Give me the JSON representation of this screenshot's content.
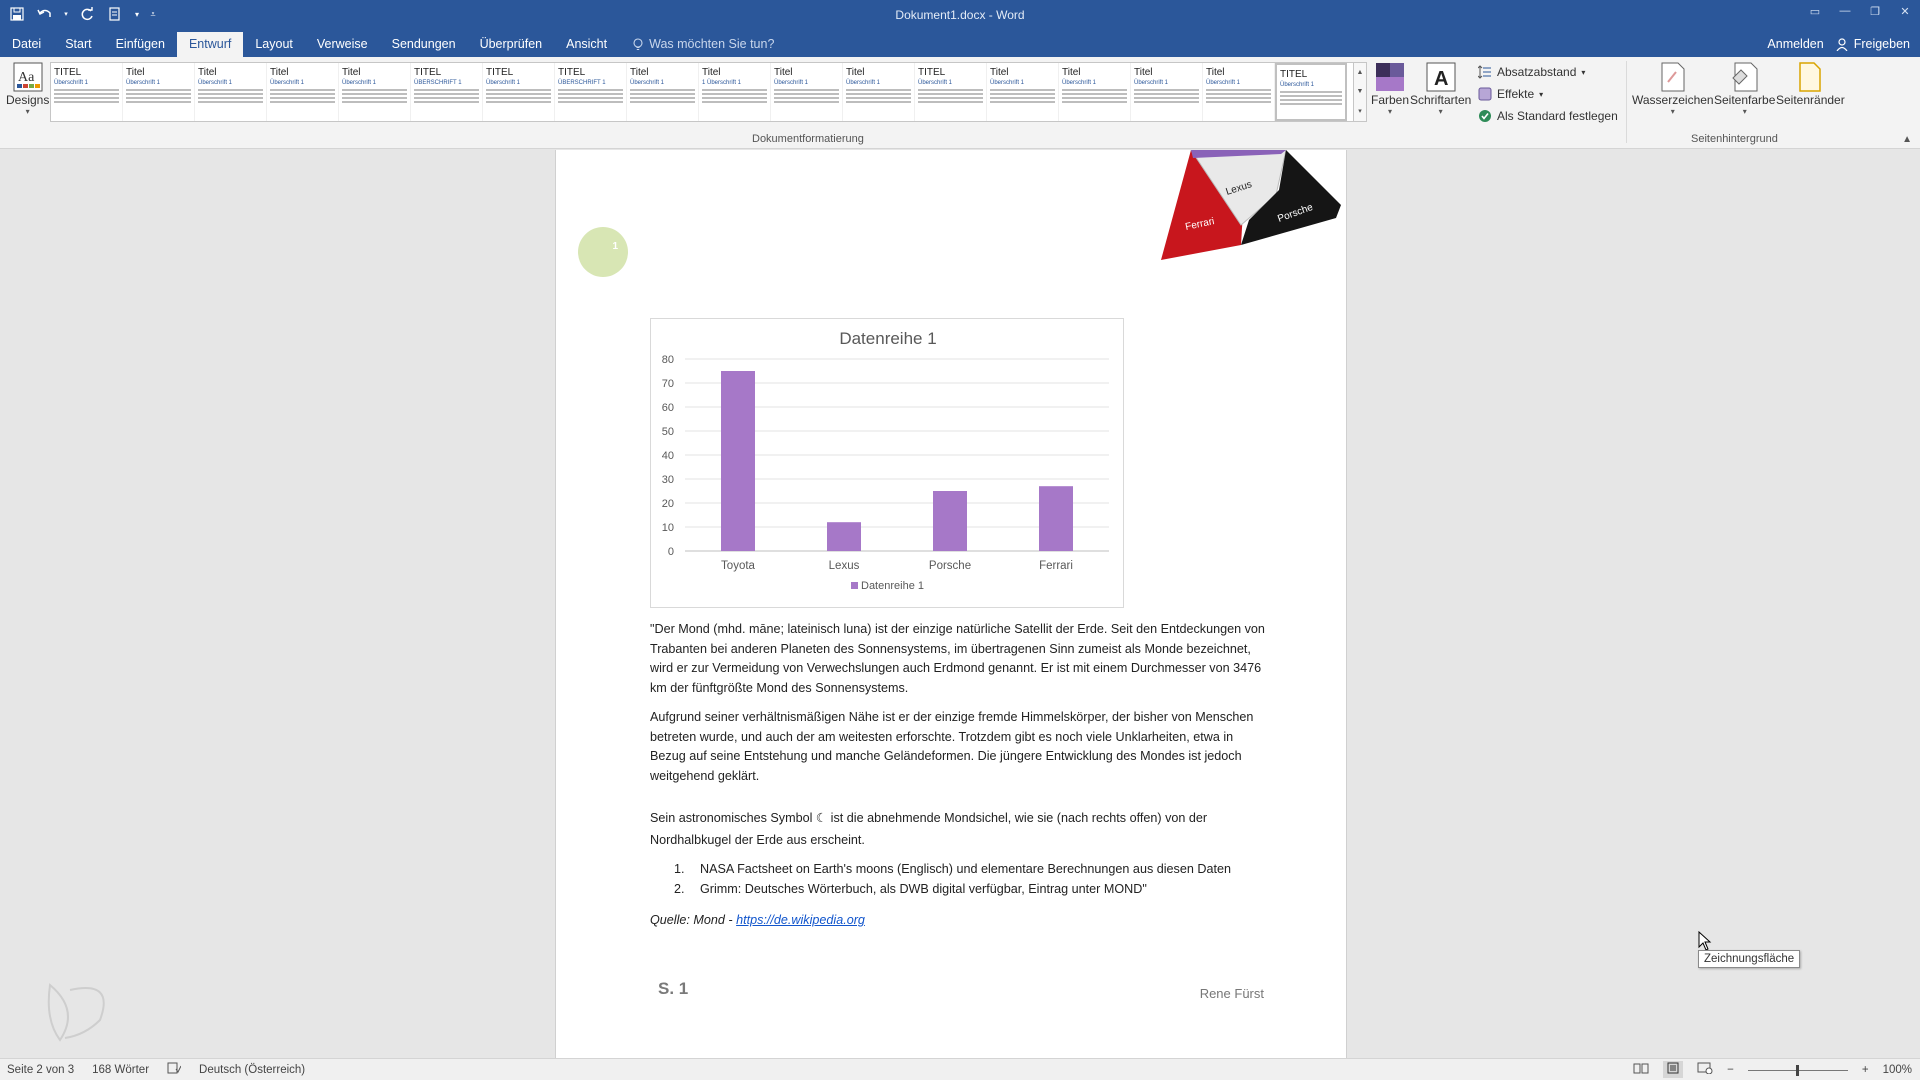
{
  "window": {
    "title": "Dokument1.docx - Word",
    "controls": [
      "restore-ribbon",
      "minimize",
      "maximize",
      "close"
    ]
  },
  "tabs": [
    {
      "label": "Datei",
      "active": false
    },
    {
      "label": "Start",
      "active": false
    },
    {
      "label": "Einfügen",
      "active": false
    },
    {
      "label": "Entwurf",
      "active": true
    },
    {
      "label": "Layout",
      "active": false
    },
    {
      "label": "Verweise",
      "active": false
    },
    {
      "label": "Sendungen",
      "active": false
    },
    {
      "label": "Überprüfen",
      "active": false
    },
    {
      "label": "Ansicht",
      "active": false
    }
  ],
  "tellme": {
    "placeholder": "Was möchten Sie tun?"
  },
  "account": {
    "signin": "Anmelden",
    "share": "Freigeben"
  },
  "ribbon": {
    "designs_label": "Designs",
    "gallery_styles": [
      {
        "title": "TITEL",
        "heading": "Überschrift 1"
      },
      {
        "title": "Titel",
        "heading": "Überschrift 1"
      },
      {
        "title": "Titel",
        "heading": "Überschrift 1"
      },
      {
        "title": "Titel",
        "heading": "Überschrift 1"
      },
      {
        "title": "Titel",
        "heading": "Überschrift 1"
      },
      {
        "title": "TITEL",
        "heading": "ÜBERSCHRIFT 1"
      },
      {
        "title": "TITEL",
        "heading": "Überschrift 1"
      },
      {
        "title": "TITEL",
        "heading": "ÜBERSCHRIFT 1"
      },
      {
        "title": "Titel",
        "heading": "Überschrift 1"
      },
      {
        "title": "Titel",
        "heading": "1 Überschrift 1"
      },
      {
        "title": "Titel",
        "heading": "Überschrift 1"
      },
      {
        "title": "Titel",
        "heading": "Überschrift 1"
      },
      {
        "title": "TITEL",
        "heading": "Überschrift 1"
      },
      {
        "title": "Titel",
        "heading": "Überschrift 1"
      },
      {
        "title": "Titel",
        "heading": "Überschrift 1"
      },
      {
        "title": "Titel",
        "heading": "Überschrift 1"
      },
      {
        "title": "Titel",
        "heading": "Überschrift 1"
      },
      {
        "title": "TITEL",
        "heading": "Überschrift 1"
      }
    ],
    "colors_label": "Farben",
    "fonts_label": "Schriftarten",
    "paragraph_spacing": "Absatzabstand",
    "effects": "Effekte",
    "set_default": "Als Standard festlegen",
    "group_docformat": "Dokumentformatierung",
    "watermark": "Wasserzeichen",
    "page_color": "Seitenfarbe",
    "page_borders": "Seitenränder",
    "group_background": "Seitenhintergrund"
  },
  "document": {
    "circle_number": "1",
    "pyramid_labels": [
      "Lexus",
      "Porsche",
      "Ferrari"
    ],
    "paragraphs": [
      "\"Der Mond (mhd. māne; lateinisch luna) ist der einzige natürliche Satellit der Erde. Seit den Entdeckungen von Trabanten bei anderen Planeten des Sonnensystems, im übertragenen Sinn zumeist als Monde bezeichnet, wird er zur Vermeidung von Verwechslungen auch Erdmond genannt. Er ist mit einem Durchmesser von 3476 km der fünftgrößte Mond des Sonnensystems.",
      "Aufgrund seiner verhältnismäßigen Nähe ist er der einzige fremde Himmelskörper, der bisher von Menschen betreten wurde, und auch der am weitesten erforschte. Trotzdem gibt es noch viele Unklarheiten, etwa in Bezug auf seine Entstehung und manche Geländeformen. Die jüngere Entwicklung des Mondes ist jedoch weitgehend geklärt.",
      "Sein astronomisches Symbol ☾ ist die abnehmende Mondsichel, wie sie (nach rechts offen) von der Nordhalbkugel der Erde aus erscheint."
    ],
    "list": [
      {
        "num": "1.",
        "text": "NASA Factsheet on Earth's moons (Englisch) und elementare Berechnungen aus diesen Daten"
      },
      {
        "num": "2.",
        "text": "Grimm: Deutsches Wörterbuch, als DWB digital verfügbar, Eintrag unter MOND\""
      }
    ],
    "source_prefix": "Quelle: Mond - ",
    "source_link": "https://de.wikipedia.org",
    "footer_page": "S. 1",
    "footer_author": "Rene Fürst"
  },
  "chart_data": {
    "type": "bar",
    "title": "Datenreihe 1",
    "categories": [
      "Toyota",
      "Lexus",
      "Porsche",
      "Ferrari"
    ],
    "series": [
      {
        "name": "Datenreihe 1",
        "values": [
          75,
          12,
          25,
          27
        ]
      }
    ],
    "ylim": [
      0,
      80
    ],
    "yticks": [
      0,
      10,
      20,
      30,
      40,
      50,
      60,
      70,
      80
    ],
    "grid": true,
    "legend": "bottom",
    "bar_color": "#a678c8"
  },
  "tooltip": "Zeichnungsfläche",
  "status": {
    "page": "Seite 2 von 3",
    "words": "168 Wörter",
    "language": "Deutsch (Österreich)",
    "zoom": "100%"
  },
  "colors": {
    "accent": "#2b579a",
    "chart_bar": "#a678c8"
  }
}
